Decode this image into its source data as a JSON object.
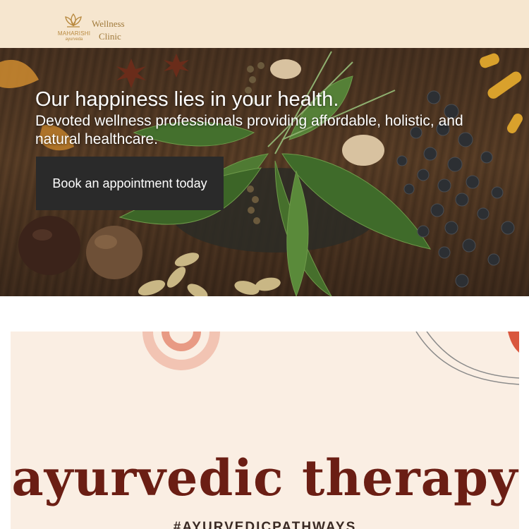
{
  "header": {
    "logo": {
      "word": "MAHARISHI",
      "sub": "ayurveda",
      "color": "#b8893f"
    },
    "brand_line1": "Wellness",
    "brand_line2": "Clinic",
    "background": "#f6e6cf"
  },
  "hero": {
    "title": "Our happiness lies in your health.",
    "subtitle": "Devoted wellness professionals providing affordable, holistic, and natural healthcare.",
    "cta_label": "Book an appointment today"
  },
  "banner": {
    "title": "ayurvedic therapy",
    "hashtag": "#AYURVEDICPATHWAYS",
    "title_color": "#6b1e14",
    "background": "#faeee3"
  }
}
